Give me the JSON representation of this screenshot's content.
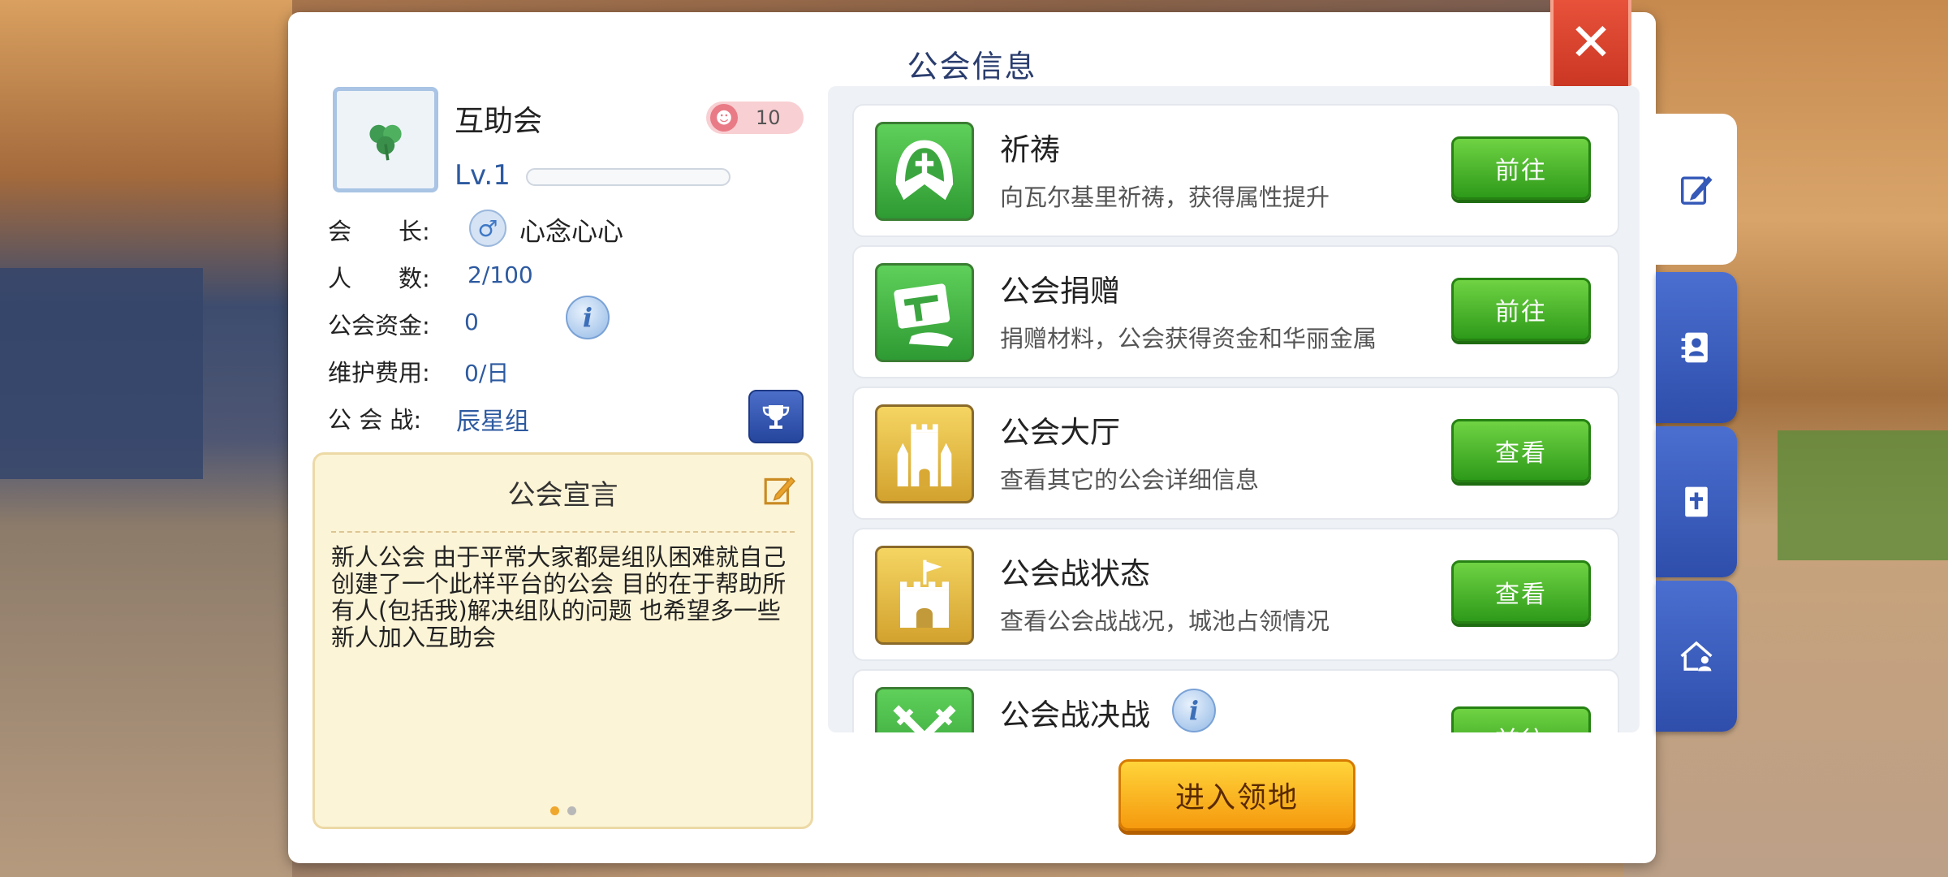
{
  "panel": {
    "title": "公会信息",
    "close_icon": "close-icon"
  },
  "guild": {
    "name": "互助会",
    "rank_value": "10",
    "level": "Lv.1",
    "level_progress": 0,
    "leader_label": "会　　长:",
    "leader_name": "心念心心",
    "members_label": "人　　数:",
    "members_value": "2/100",
    "funds_label": "公会资金:",
    "funds_value": "0",
    "upkeep_label": "维护费用:",
    "upkeep_value": "0/日",
    "war_label": "公 会 战:",
    "war_value": "辰星组"
  },
  "declaration": {
    "title": "公会宣言",
    "text": "新人公会 由于平常大家都是组队困难就自己创建了一个此样平台的公会 目的在于帮助所有人(包括我)解决组队的问题 也希望多一些新人加入互助会",
    "page_index": 0,
    "page_count": 2
  },
  "features": [
    {
      "title": "祈祷",
      "desc": "向瓦尔基里祈祷，获得属性提升",
      "button": "前往",
      "icon": "prayer-icon",
      "color": "green"
    },
    {
      "title": "公会捐赠",
      "desc": "捐赠材料，公会获得资金和华丽金属",
      "button": "前往",
      "icon": "donation-icon",
      "color": "green"
    },
    {
      "title": "公会大厅",
      "desc": "查看其它的公会详细信息",
      "button": "查看",
      "icon": "castle-hall-icon",
      "color": "gold"
    },
    {
      "title": "公会战状态",
      "desc": "查看公会战战况，城池占领情况",
      "button": "查看",
      "icon": "castle-flag-icon",
      "color": "gold"
    },
    {
      "title": "公会战决战",
      "desc": "",
      "button": "前往",
      "icon": "crossed-swords-icon",
      "color": "green"
    }
  ],
  "enter_button": "进入领地",
  "side_tabs": [
    {
      "icon": "edit-icon",
      "active": true
    },
    {
      "icon": "contacts-icon",
      "active": false
    },
    {
      "icon": "bible-icon",
      "active": false
    },
    {
      "icon": "guild-house-icon",
      "active": false
    }
  ],
  "colors": {
    "accent_blue": "#2d5aa0",
    "button_green": "#3fae24",
    "button_orange": "#f7a81c",
    "close_red": "#d9412b"
  }
}
